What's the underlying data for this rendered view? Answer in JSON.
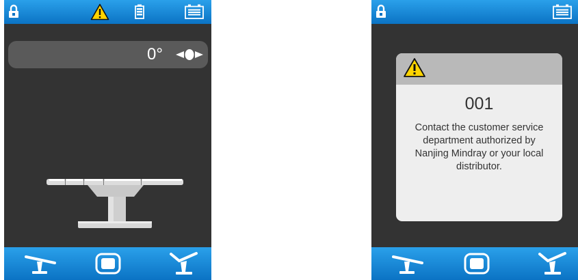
{
  "colors": {
    "bar_top": "#2aa0ea",
    "bar_bottom": "#0b73c4",
    "screen_bg": "#333333",
    "warning_yellow": "#ffd400",
    "dialog_bg": "#eeeeee",
    "dialog_header": "#b9b9b9"
  },
  "left_screen": {
    "status_icons": [
      "lock-icon",
      "warning-icon",
      "battery-icon",
      "power-supply-icon"
    ],
    "angle": {
      "value": "0°",
      "icon": "tilt-indicator-icon"
    },
    "table_illustration": "operating-table-icon",
    "nav_icons": [
      "table-position-icon",
      "display-icon",
      "chair-position-icon"
    ]
  },
  "right_screen": {
    "status_icons": [
      "lock-icon",
      "power-supply-icon"
    ],
    "dialog": {
      "icon": "warning-icon",
      "code": "001",
      "message": "Contact the customer service department authorized by Nanjing Mindray or your local distributor."
    },
    "nav_icons": [
      "table-position-icon",
      "display-icon",
      "chair-position-icon"
    ]
  }
}
